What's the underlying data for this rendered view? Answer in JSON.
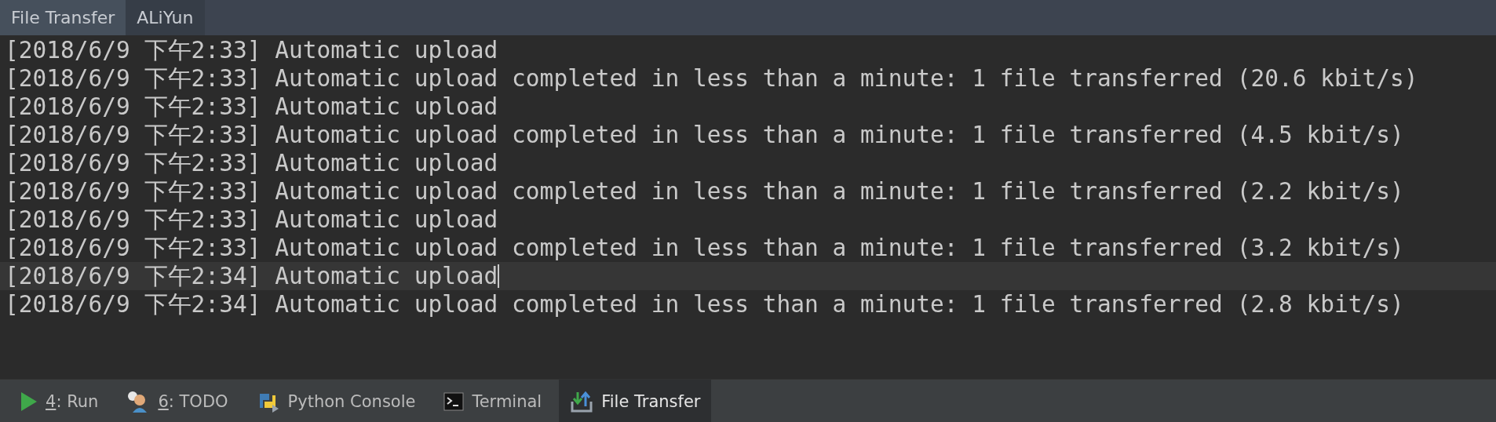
{
  "tabs": [
    {
      "label": "File Transfer",
      "selected": true
    },
    {
      "label": "ALiYun",
      "selected": false
    }
  ],
  "log": [
    {
      "text": "[2018/6/9 下午2:33] Automatic upload",
      "current": false
    },
    {
      "text": "[2018/6/9 下午2:33] Automatic upload completed in less than a minute: 1 file transferred (20.6 kbit/s)",
      "current": false
    },
    {
      "text": "[2018/6/9 下午2:33] Automatic upload",
      "current": false
    },
    {
      "text": "[2018/6/9 下午2:33] Automatic upload completed in less than a minute: 1 file transferred (4.5 kbit/s)",
      "current": false
    },
    {
      "text": "[2018/6/9 下午2:33] Automatic upload",
      "current": false
    },
    {
      "text": "[2018/6/9 下午2:33] Automatic upload completed in less than a minute: 1 file transferred (2.2 kbit/s)",
      "current": false
    },
    {
      "text": "[2018/6/9 下午2:33] Automatic upload",
      "current": false
    },
    {
      "text": "[2018/6/9 下午2:33] Automatic upload completed in less than a minute: 1 file transferred (3.2 kbit/s)",
      "current": false
    },
    {
      "text": "[2018/6/9 下午2:34] Automatic upload",
      "current": true
    },
    {
      "text": "[2018/6/9 下午2:34] Automatic upload completed in less than a minute: 1 file transferred (2.8 kbit/s)",
      "current": false
    }
  ],
  "tool_windows": [
    {
      "kind": "run",
      "mnemonic": "4",
      "label": ": Run",
      "selected": false
    },
    {
      "kind": "todo",
      "mnemonic": "6",
      "label": ": TODO",
      "selected": false
    },
    {
      "kind": "python",
      "label": "Python Console",
      "selected": false
    },
    {
      "kind": "terminal",
      "label": "Terminal",
      "selected": false
    },
    {
      "kind": "transfer",
      "label": "File Transfer",
      "selected": true
    }
  ]
}
